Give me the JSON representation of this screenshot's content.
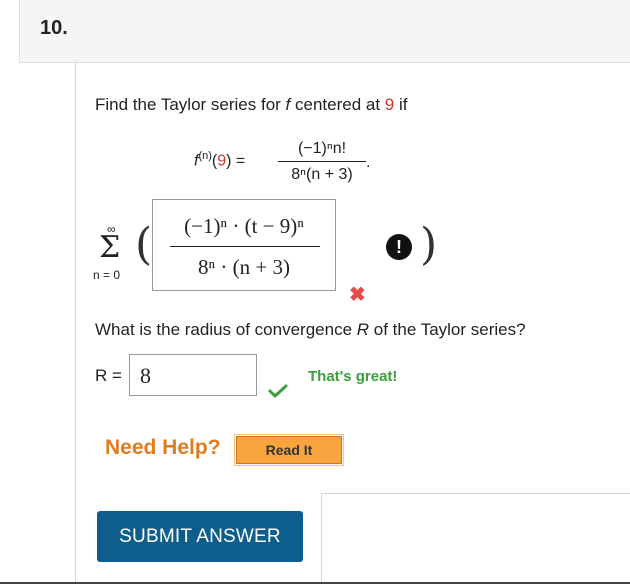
{
  "question": {
    "number": "10."
  },
  "prompt": {
    "part1": "Find the Taylor series for ",
    "fn": "f",
    "part2": " centered at ",
    "center": "9",
    "part3": " if"
  },
  "given": {
    "f": "f",
    "sup": "(n)",
    "arg_open": "(",
    "arg": "9",
    "arg_close": ") =",
    "numerator": "(−1)ⁿn!",
    "denominator": "8ⁿ(n + 3)",
    "period": "."
  },
  "series": {
    "upper": "∞",
    "sigma": "Σ",
    "lower": "n = 0",
    "left_paren": "(",
    "right_paren": ")"
  },
  "answer": {
    "numerator": "(−1)ⁿ · (t − 9)ⁿ",
    "denominator": "8ⁿ · (n + 3)",
    "status_icon": "x-mark-icon",
    "status_color": "#e34b4b",
    "alert_glyph": "!"
  },
  "radius_question": {
    "part1": "What is the radius of convergence ",
    "var": "R",
    "part2": " of the Taylor series?"
  },
  "radius": {
    "label": "R =",
    "value": "8",
    "feedback": "That's great!",
    "status_icon": "check-icon",
    "feedback_color": "#3aa13a"
  },
  "help": {
    "label": "Need Help?",
    "read_button": "Read It"
  },
  "submit": {
    "label": "SUBMIT ANSWER",
    "color": "#0d5e8d"
  }
}
